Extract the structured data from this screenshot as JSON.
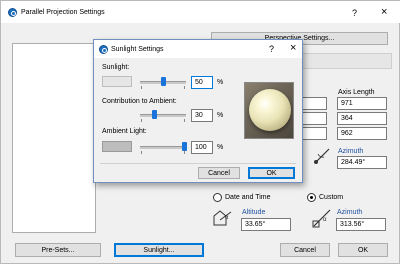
{
  "main_window": {
    "title": "Parallel Projection Settings",
    "help": "?",
    "close": "×",
    "perspective_button": "Perspective Settings...",
    "axis_length_header": "Axis Length",
    "axis_values": [
      "971",
      "364",
      "962"
    ],
    "azimuth_label_upper": "Azimuth",
    "azimuth_value_upper": "284.49°",
    "date_time_label": "Date and Time",
    "custom_label": "Custom",
    "altitude_label": "Altitude",
    "altitude_value": "33.65°",
    "azimuth_label": "Azimuth",
    "azimuth_value": "313.56°",
    "presets_button": "Pre-Sets...",
    "sunlight_button": "Sunlight...",
    "cancel_button": "Cancel",
    "ok_button": "OK"
  },
  "sunlight_dialog": {
    "title": "Sunlight Settings",
    "help": "?",
    "close": "×",
    "sunlight_label": "Sunlight:",
    "sunlight_value": "50",
    "contribution_label": "Contribution to Ambient:",
    "contribution_value": "30",
    "ambient_label": "Ambient Light:",
    "ambient_value": "100",
    "percent": "%",
    "sunlight_level": 0.5,
    "contribution_level": 0.3,
    "ambient_level": 1.0,
    "cancel_button": "Cancel",
    "ok_button": "OK"
  }
}
